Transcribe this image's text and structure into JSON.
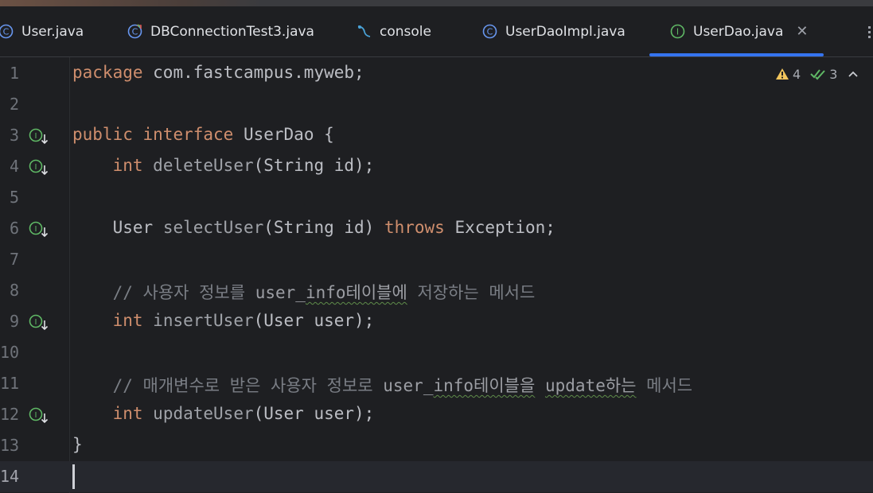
{
  "tabs": [
    {
      "label": "User.java",
      "icon": "class-icon"
    },
    {
      "label": "DBConnectionTest3.java",
      "icon": "test-class-icon"
    },
    {
      "label": "console",
      "icon": "console-icon"
    },
    {
      "label": "UserDaoImpl.java",
      "icon": "class-icon"
    },
    {
      "label": "UserDao.java",
      "icon": "interface-icon",
      "active": true
    }
  ],
  "colors": {
    "accent": "#3574f0",
    "keyword": "#cf8e6d",
    "interface_icon": "#5fb865",
    "class_icon": "#6897f0",
    "warning": "#f2c55c"
  },
  "inspections": {
    "warnings": "4",
    "weak_warnings": "3"
  },
  "lines": [
    {
      "n": "1",
      "package_kw": "package",
      "package_name": " com.fastcampus.myweb;"
    },
    {
      "n": "2"
    },
    {
      "n": "3",
      "mod": "public",
      "kw": "interface",
      "name": " UserDao ",
      "brace": "{"
    },
    {
      "n": "4",
      "ret": "int",
      "method": "deleteUser",
      "params": "(String id);"
    },
    {
      "n": "5"
    },
    {
      "n": "6",
      "ret": "User",
      "method": "selectUser",
      "params": "(String id) ",
      "throws": "throws",
      "exc": " Exception;"
    },
    {
      "n": "7"
    },
    {
      "n": "8",
      "c1": "// 사용자 정보를 ",
      "c2": "user_",
      "c3": "info테이블에",
      "c4": " 저장하는 메서드"
    },
    {
      "n": "9",
      "ret": "int",
      "method": "insertUser",
      "params": "(User user);"
    },
    {
      "n": "10"
    },
    {
      "n": "11",
      "c1": "// 매개변수로 받은 사용자 정보로 ",
      "c2": "user_",
      "c3": "info테이블을",
      "c4": " ",
      "c5": "update하는",
      "c6": " 메서드"
    },
    {
      "n": "12",
      "ret": "int",
      "method": "updateUser",
      "params": "(User user);"
    },
    {
      "n": "13",
      "brace": "}"
    },
    {
      "n": "14"
    }
  ]
}
